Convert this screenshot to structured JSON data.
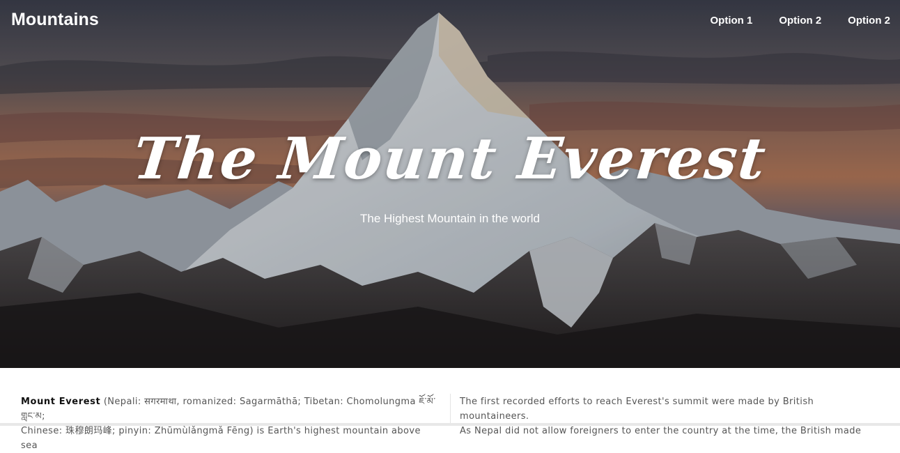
{
  "header": {
    "brand": "Mountains",
    "nav": [
      "Option 1",
      "Option 2",
      "Option 2"
    ]
  },
  "hero": {
    "title": "The Mount Everest",
    "subtitle": "The Highest Mountain in the world"
  },
  "article": {
    "left_bold": "Mount Everest",
    "left_line1": " (Nepali: सगरमाथा, romanized: Sagarmāthā; Tibetan: Chomolungma ཇོ་མོ་གླང་མ;",
    "left_line2": "Chinese: 珠穆朗玛峰; pinyin: Zhūmùlǎngmǎ Fēng) is Earth's highest mountain above sea",
    "right_line1": "The first recorded efforts to reach Everest's summit were made by British mountaineers.",
    "right_line2": "As Nepal did not allow foreigners to enter the country at the time, the British made"
  },
  "colors": {
    "hero_sky_warm": "#b67b5e",
    "snow": "#e9eef3",
    "rock": "#2d2a2a"
  }
}
